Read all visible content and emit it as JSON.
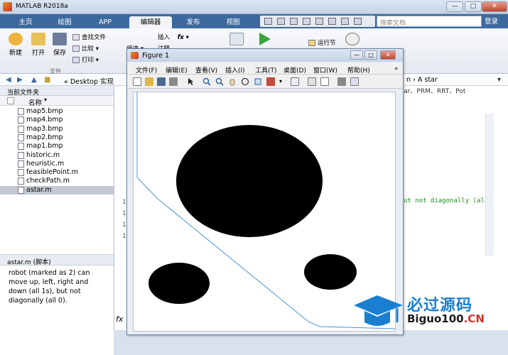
{
  "window": {
    "title": "MATLAB R2018a",
    "minimize": "—",
    "maximize": "□",
    "close": "✕"
  },
  "ribbon_tabs": [
    "主页",
    "绘图",
    "APP",
    "编辑器",
    "发布",
    "视图"
  ],
  "active_tab": "编辑器",
  "search": {
    "placeholder": "搜索文档"
  },
  "login_label": "登录",
  "toolbar": {
    "new_label": "新建",
    "open_label": "打开",
    "save_label": "保存",
    "find_files_label": "查找文件",
    "compare_label": "比较",
    "print_label": "打印",
    "group_file_label": "文件",
    "insert_label": "插入",
    "annotation_label": "注释",
    "indent_label": "缩进",
    "run_section_label": "运行节"
  },
  "address": {
    "path": "« Desktop  实现",
    "right_path": "n  ›  A star"
  },
  "current_folder_label": "当前文件夹",
  "file_list": {
    "column_header": "名称",
    "files": [
      {
        "name": "map5.bmp",
        "selected": false
      },
      {
        "name": "map4.bmp",
        "selected": false
      },
      {
        "name": "map3.bmp",
        "selected": false
      },
      {
        "name": "map2.bmp",
        "selected": false
      },
      {
        "name": "map1.bmp",
        "selected": false
      },
      {
        "name": "historic.m",
        "selected": false
      },
      {
        "name": "heuristic.m",
        "selected": false
      },
      {
        "name": "feasiblePoint.m",
        "selected": false
      },
      {
        "name": "checkPath.m",
        "selected": false
      },
      {
        "name": "astar.m",
        "selected": true
      }
    ]
  },
  "details": {
    "header": "astar.m  (脚本)",
    "text": "robot (marked as 2) can move up, left, right and down (all 1s), but not diagonally (all 0)."
  },
  "editor": {
    "tabs_text": "star、PRM、RRT、Pot",
    "code_fragment": "ut not diagonally (al",
    "line_numbers": [
      "1",
      "1",
      "1",
      "1"
    ],
    "cmd_prompt": "fx"
  },
  "figure": {
    "title": "Figure 1",
    "menu": [
      "文件(F)",
      "编辑(E)",
      "查看(V)",
      "插入(I)",
      "工具(T)",
      "桌面(D)",
      "窗口(W)",
      "帮助(H)"
    ],
    "path_color": "#4a90d9",
    "obstacle_color": "#000000"
  },
  "watermark": {
    "cn_text": "必过源码",
    "en_text": "Biguo100",
    "domain_suffix": ".CN"
  }
}
